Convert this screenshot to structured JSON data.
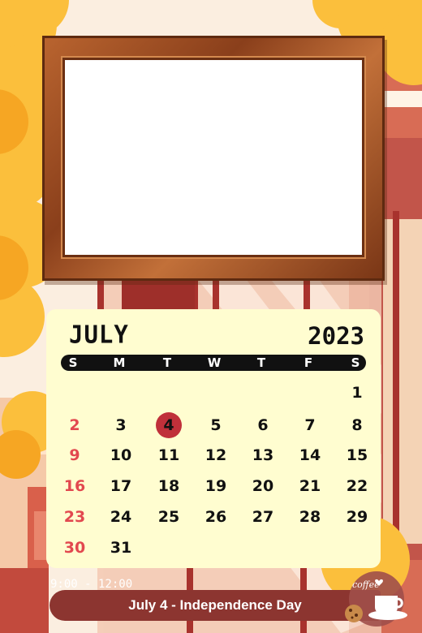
{
  "calendar": {
    "month": "JULY",
    "year": "2023",
    "weekdays": [
      "S",
      "M",
      "T",
      "W",
      "T",
      "F",
      "S"
    ],
    "weeks": [
      [
        "",
        "",
        "",
        "",
        "",
        "",
        "1"
      ],
      [
        "2",
        "3",
        "4",
        "5",
        "6",
        "7",
        "8"
      ],
      [
        "9",
        "10",
        "11",
        "12",
        "13",
        "14",
        "15"
      ],
      [
        "16",
        "17",
        "18",
        "19",
        "20",
        "21",
        "22"
      ],
      [
        "23",
        "24",
        "25",
        "26",
        "27",
        "28",
        "29"
      ],
      [
        "30",
        "31",
        "",
        "",
        "",
        "",
        ""
      ]
    ],
    "highlighted_day": "4"
  },
  "event": {
    "label": "July 4 - Independence Day"
  },
  "storefront": {
    "hours": "9:00 - 12:00",
    "badge_text": "coffee"
  },
  "colors": {
    "accent_red": "#c0303a",
    "sunday_red": "#e2484f",
    "banner": "#8c3530",
    "card": "#fffdd0",
    "frame_wood": "#a6532a",
    "background_orange": "#f9b13a"
  },
  "icons": [
    "picture-frame-icon",
    "coffee-cup-icon",
    "cookie-icon",
    "heart-icon"
  ]
}
